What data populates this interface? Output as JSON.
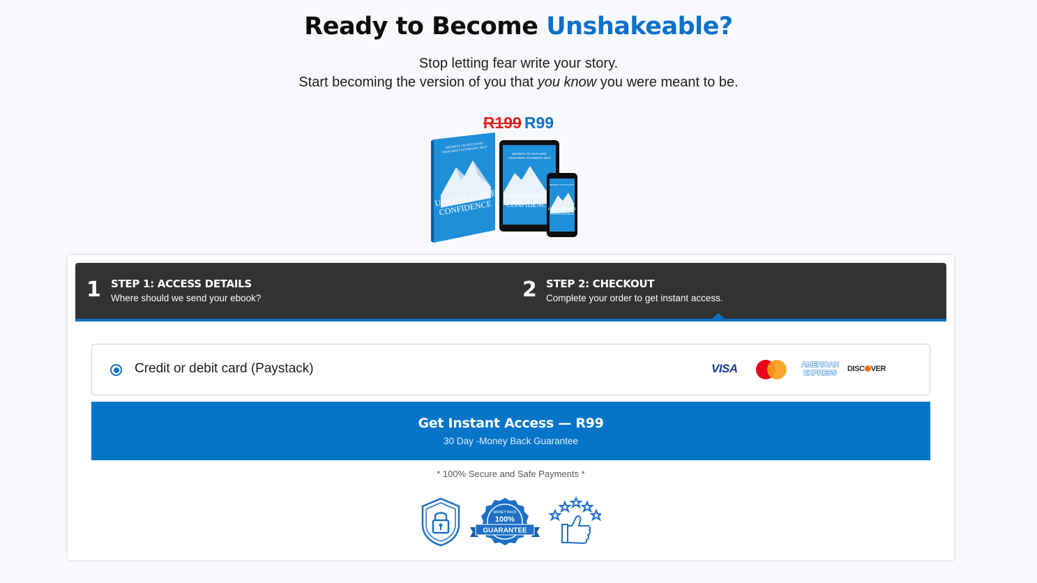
{
  "headline": {
    "prefix": "Ready to Become ",
    "accent": "Unshakeable?"
  },
  "subheading": {
    "line1": "Stop letting fear write your story.",
    "line2_start": "Start becoming the version of you that ",
    "line2_emphasis": "you know",
    "line2_end": " you were meant to be."
  },
  "price": {
    "original": "R199",
    "current": "R99"
  },
  "product": {
    "cover_tagline_1": "SECRETS TO OUTLIVING",
    "cover_tagline_2": "YOUR MOST AUTHENTIC SELF",
    "cover_title_1": "UNSHAKEABLE",
    "cover_title_2": "CONFIDENCE",
    "cover_color": "#1e8fd8"
  },
  "steps": [
    {
      "number": "1",
      "title": "STEP 1: ACCESS DETAILS",
      "description": "Where should we send your ebook?"
    },
    {
      "number": "2",
      "title": "STEP 2: CHECKOUT",
      "description": "Complete your order to get instant access."
    }
  ],
  "payment": {
    "option_label": "Credit or debit card (Paystack)",
    "selected": true,
    "logos": {
      "visa": "VISA",
      "amex_line1": "AMERICAN",
      "amex_line2": "EXPRESS",
      "discover_a": "DISC",
      "discover_b": "VER"
    }
  },
  "cta": {
    "label": "Get Instant Access — R99",
    "sublabel": "30 Day -Money Back Guarantee"
  },
  "secure_note": "* 100% Secure and Safe Payments *",
  "badges": {
    "guarantee_arc": "MONEY BACK",
    "guarantee_percent": "100%",
    "guarantee_ribbon": "GUARANTEE",
    "icons": [
      "shield-lock-icon",
      "money-back-guarantee-seal-icon",
      "thumbs-up-stars-icon"
    ]
  },
  "colors": {
    "accent": "#0e70c9",
    "cta": "#0474c9",
    "strike_price": "#e01e1e",
    "steps_bar": "#323232"
  }
}
